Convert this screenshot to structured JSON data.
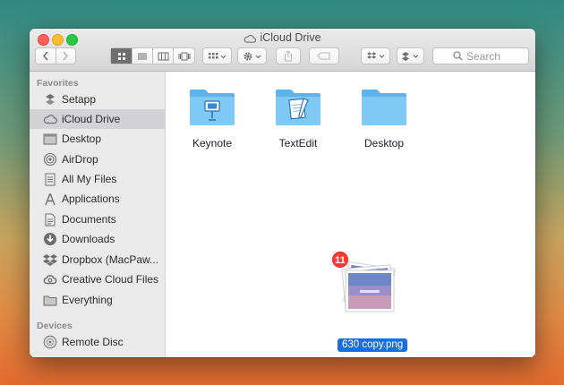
{
  "window": {
    "title": "iCloud Drive"
  },
  "toolbar": {
    "back_icon": "chevron-left-icon",
    "forward_icon": "chevron-right-icon",
    "view_modes": [
      "icon-view",
      "list-view",
      "column-view",
      "coverflow-view"
    ],
    "active_view": "icon-view",
    "search_placeholder": "Search"
  },
  "sidebar": {
    "favorites_header": "Favorites",
    "devices_header": "Devices",
    "favorites": [
      {
        "label": "Setapp",
        "icon": "setapp-icon"
      },
      {
        "label": "iCloud Drive",
        "icon": "cloud-icon",
        "selected": true
      },
      {
        "label": "Desktop",
        "icon": "desktop-icon"
      },
      {
        "label": "AirDrop",
        "icon": "airdrop-icon"
      },
      {
        "label": "All My Files",
        "icon": "all-files-icon"
      },
      {
        "label": "Applications",
        "icon": "applications-icon"
      },
      {
        "label": "Documents",
        "icon": "documents-icon"
      },
      {
        "label": "Downloads",
        "icon": "downloads-icon"
      },
      {
        "label": "Dropbox (MacPaw...",
        "icon": "dropbox-icon"
      },
      {
        "label": "Creative Cloud Files",
        "icon": "creative-cloud-icon"
      },
      {
        "label": "Everything",
        "icon": "folder-icon"
      }
    ],
    "devices": [
      {
        "label": "Remote Disc",
        "icon": "remote-disc-icon"
      }
    ]
  },
  "content": {
    "folders": [
      {
        "label": "Keynote",
        "icon": "keynote-folder-icon"
      },
      {
        "label": "TextEdit",
        "icon": "textedit-folder-icon"
      },
      {
        "label": "Desktop",
        "icon": "folder-icon"
      }
    ],
    "drag_item": {
      "label": "630 copy.png",
      "badge_count": "11"
    }
  },
  "colors": {
    "selection": "#1a6fe0",
    "folder": "#6cc0f0",
    "badge": "#ff3b30"
  }
}
